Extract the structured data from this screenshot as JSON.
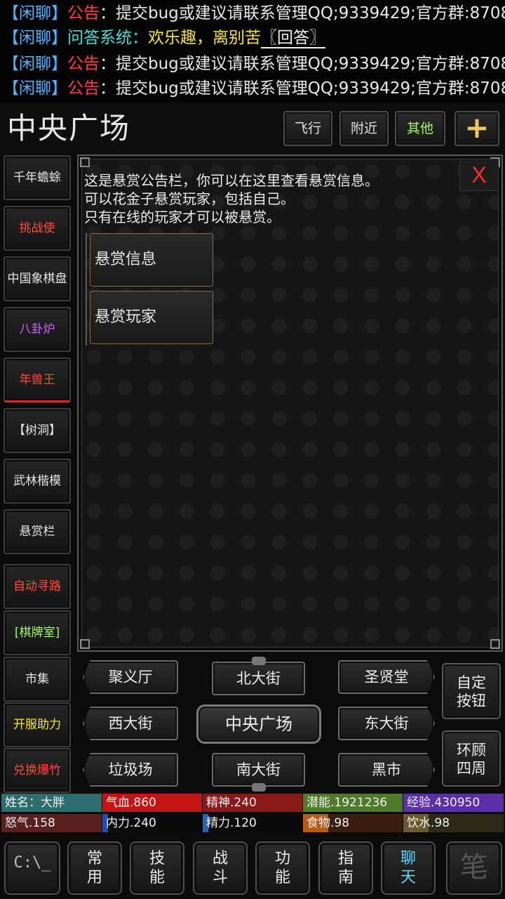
{
  "chat": {
    "lines": [
      {
        "channel": "【闲聊】",
        "kind": "公告",
        "sep": "：",
        "text": "提交bug或建议请联系管理QQ;9339429;官方群:8708"
      },
      {
        "channel": "【闲聊】",
        "kind": "问答系统",
        "sep": "：",
        "text": "欢乐趣，离别苦",
        "answer": "〖回答〗"
      },
      {
        "channel": "【闲聊】",
        "kind": "公告",
        "sep": "：",
        "text": "提交bug或建议请联系管理QQ;9339429;官方群:8708"
      },
      {
        "channel": "【闲聊】",
        "kind": "公告",
        "sep": "：",
        "text": "提交bug或建议请联系管理QQ;9339429;官方群:8708"
      }
    ]
  },
  "location": {
    "title": "中央广场",
    "fly": "飞行",
    "nearby": "附近",
    "other": "其他",
    "plus": "+"
  },
  "sidebar": {
    "items": [
      {
        "label": "千年蟾蜍"
      },
      {
        "label": "挑战使"
      },
      {
        "label": "中国象棋盘"
      },
      {
        "label": "八卦炉"
      },
      {
        "label": "年兽王"
      },
      {
        "label": "【树洞】"
      },
      {
        "label": "武林楷模"
      },
      {
        "label": "悬赏栏"
      },
      {
        "label": "自动寻路"
      },
      {
        "label": "[棋牌室]"
      },
      {
        "label": "市集"
      },
      {
        "label": "开服助力"
      },
      {
        "label": "兑换爆竹"
      }
    ]
  },
  "panel": {
    "intro": [
      "这是悬赏公告栏，你可以在这里查看悬赏信息。",
      "可以花金子悬赏玩家，包括自己。",
      "只有在线的玩家才可以被悬赏。"
    ],
    "close": "X",
    "options": [
      "悬赏信息",
      "悬赏玩家"
    ]
  },
  "map": {
    "nw": "聚义厅",
    "n": "北大街",
    "ne": "圣贤堂",
    "w": "西大街",
    "center": "中央广场",
    "e": "东大街",
    "sw": "垃圾场",
    "s": "南大街",
    "se": "黑市",
    "custom": [
      "自定",
      "按钮"
    ],
    "look": [
      "环顾",
      "四周"
    ]
  },
  "status": {
    "name": "姓名：大胖",
    "hp": "气血.860",
    "spirit": "精神.240",
    "potential": "潜能.1921236",
    "exp": "经验.430950",
    "rage": "怒气.158",
    "neili": "内力.240",
    "jingli": "精力.120",
    "food": "食物.98",
    "water": "饮水.98"
  },
  "bottom": {
    "console": "C:\\_",
    "tabs": [
      [
        "常",
        "用"
      ],
      [
        "技",
        "能"
      ],
      [
        "战",
        "斗"
      ],
      [
        "功",
        "能"
      ],
      [
        "指",
        "南"
      ],
      [
        "聊",
        "天"
      ]
    ],
    "corner": "笔"
  },
  "colors": {
    "announce_red": "#ff3b3b",
    "channel_blue": "#4fb5ff",
    "qa_cyan": "#3fe0d8",
    "question_yellow": "#f3e437",
    "accent_red": "#ff4a3a",
    "accent_green": "#9cff5a",
    "chat_tab_blue": "#5fd7ff"
  }
}
